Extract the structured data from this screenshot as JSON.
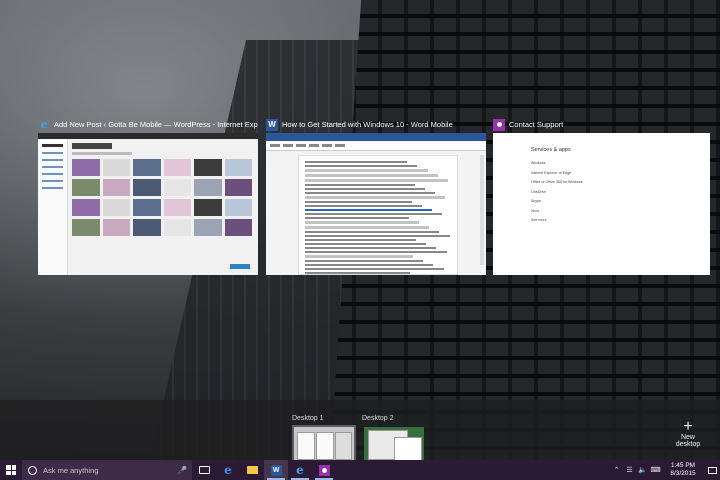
{
  "windows": [
    {
      "title": "Add New Post ‹ Gotta Be Mobile — WordPress - Internet Explorer",
      "icon": "internet-explorer-icon"
    },
    {
      "title": "How to Get Started with Windows 10 - Word Mobile",
      "icon": "word-icon"
    },
    {
      "title": "Contact Support",
      "icon": "contact-support-icon",
      "content": {
        "heading": "Services & apps",
        "items": [
          "Windows",
          "Internet Explorer or Edge",
          "Office or Office 365 for Windows",
          "OneDrive",
          "Skype",
          "Xbox",
          "See more"
        ]
      }
    }
  ],
  "desktops": [
    {
      "label": "Desktop 1",
      "selected": true
    },
    {
      "label": "Desktop 2",
      "selected": false
    }
  ],
  "new_desktop_label": "New desktop",
  "taskbar": {
    "search_placeholder": "Ask me anything",
    "time": "1:45 PM",
    "date": "8/3/2015"
  },
  "colors": {
    "taskbar": "#2b1a33",
    "word_blue": "#2b579a",
    "contact_support_purple": "#9b2fae",
    "edge_blue": "#3a8fe4"
  }
}
